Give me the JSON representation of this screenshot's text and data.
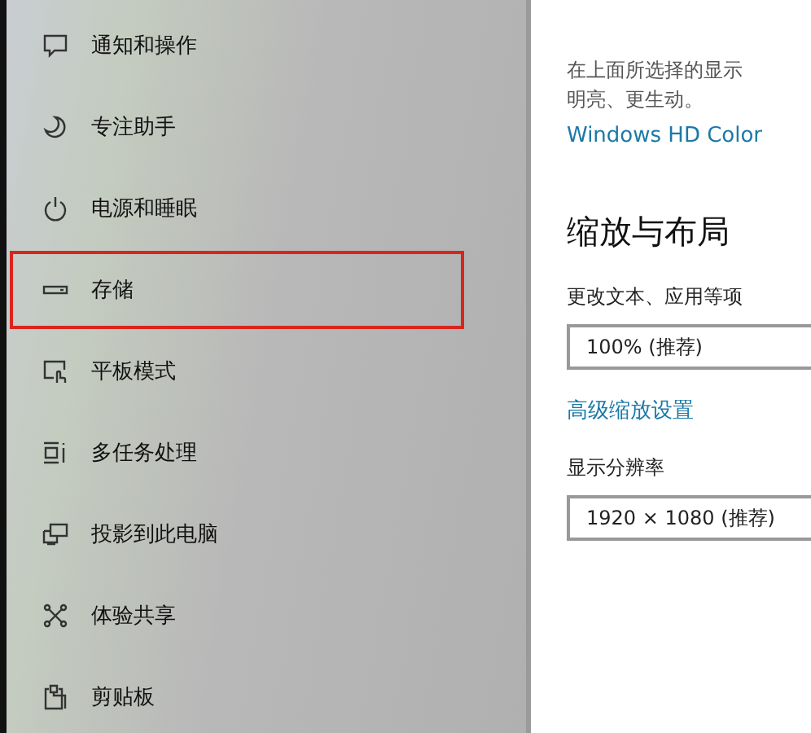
{
  "sidebar": {
    "items": [
      {
        "label": "通知和操作",
        "highlighted": false
      },
      {
        "label": "专注助手",
        "highlighted": false
      },
      {
        "label": "电源和睡眠",
        "highlighted": false
      },
      {
        "label": "存储",
        "highlighted": true
      },
      {
        "label": "平板模式",
        "highlighted": false
      },
      {
        "label": "多任务处理",
        "highlighted": false
      },
      {
        "label": "投影到此电脑",
        "highlighted": false
      },
      {
        "label": "体验共享",
        "highlighted": false
      },
      {
        "label": "剪贴板",
        "highlighted": false
      }
    ]
  },
  "content": {
    "description": [
      "在上面所选择的显示",
      "明亮、更生动。"
    ],
    "hd_color_link": "Windows HD Color",
    "section_title": "缩放与布局",
    "scale_label": "更改文本、应用等项",
    "scale_value": "100% (推荐)",
    "advanced_link": "高级缩放设置",
    "resolution_label": "显示分辨率",
    "resolution_value": "1920 × 1080 (推荐)"
  }
}
